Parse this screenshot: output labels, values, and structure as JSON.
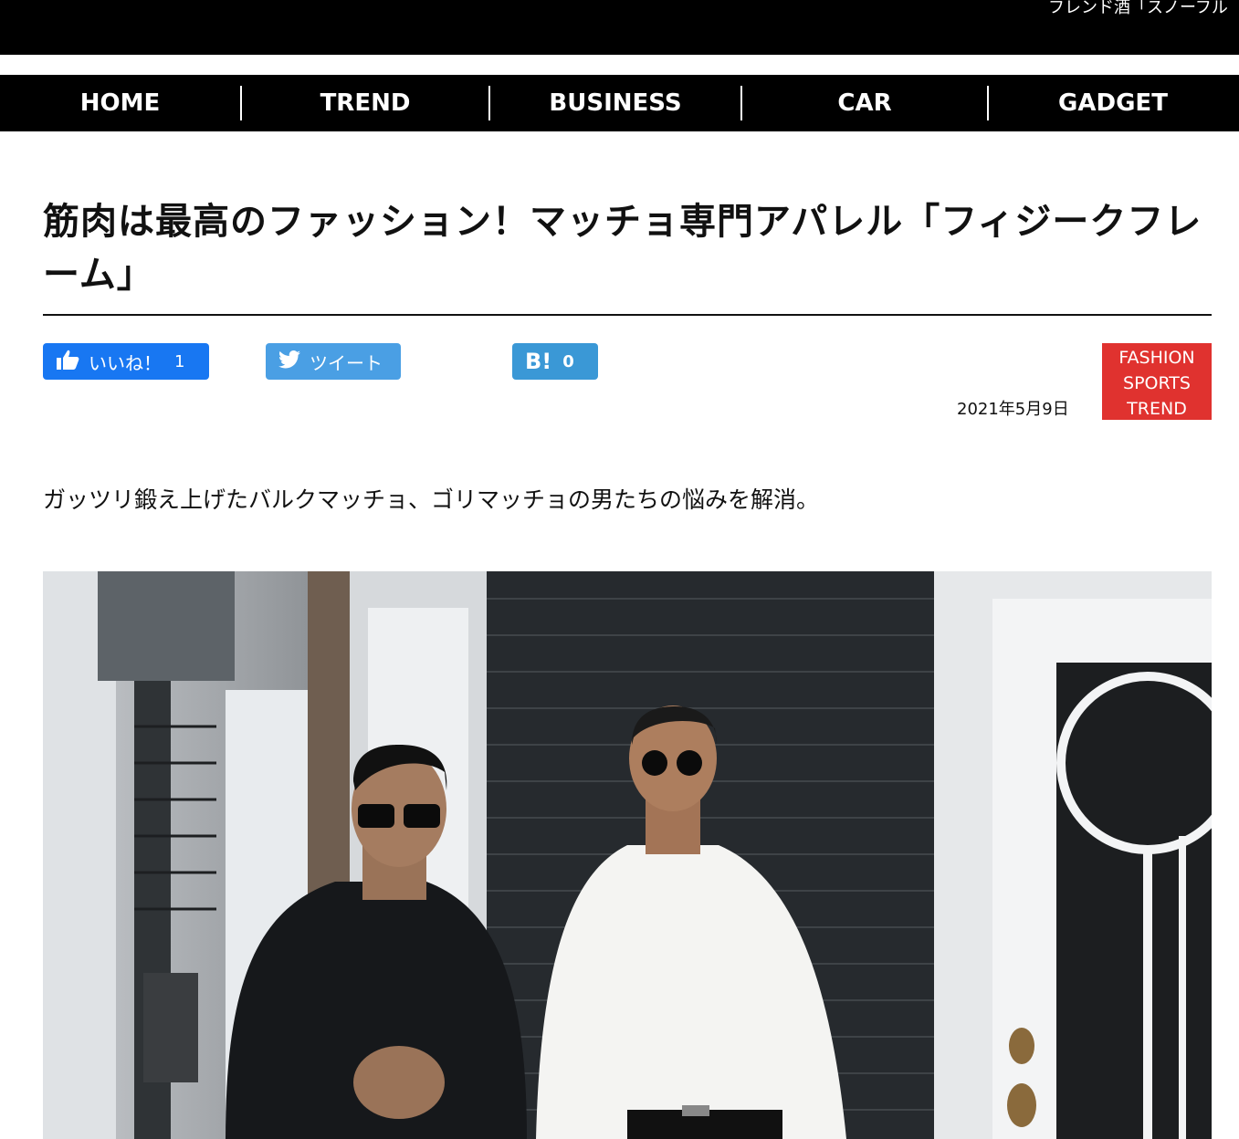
{
  "header": {
    "ticker_text": "フレンド酒「スノーフル"
  },
  "nav": {
    "items": [
      {
        "label": "HOME"
      },
      {
        "label": "TREND"
      },
      {
        "label": "BUSINESS"
      },
      {
        "label": "CAR"
      },
      {
        "label": "GADGET"
      }
    ]
  },
  "article": {
    "title": "筋肉は最高のファッション！マッチョ専門アパレル「フィジークフレーム」",
    "date": "2021年5月9日",
    "tags": [
      "FASHION",
      "SPORTS",
      "TREND"
    ],
    "lead": "ガッツリ鍛え上げたバルクマッチョ、ゴリマッチョの男たちの悩みを解消。"
  },
  "share": {
    "facebook": {
      "label": "いいね！",
      "count": "1",
      "icon": "thumbs-up-icon"
    },
    "twitter": {
      "label": "ツイート",
      "icon": "twitter-bird-icon"
    },
    "hatena": {
      "label": "B!",
      "count": "0"
    }
  },
  "colors": {
    "nav_bg": "#000000",
    "facebook": "#1877f2",
    "twitter": "#4a9fe4",
    "hatena": "#3a98d6",
    "tag_bg": "#e0322f"
  }
}
